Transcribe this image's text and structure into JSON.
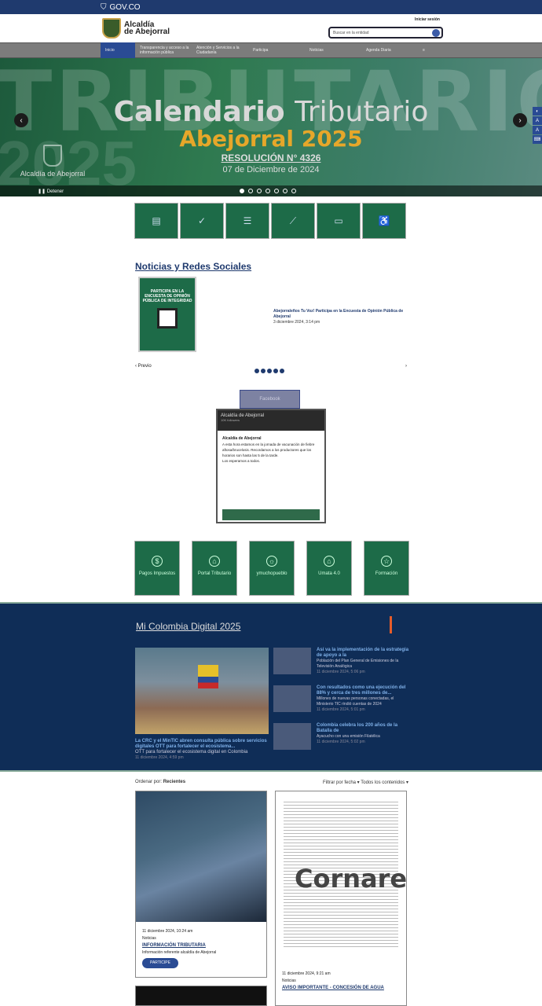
{
  "gov_bar": {
    "label": "GOV.CO"
  },
  "header": {
    "logo_line1": "Alcaldía",
    "logo_line2": "de Abejorral",
    "login": "Iniciar sesión",
    "search_placeholder": "Buscar en la entidad"
  },
  "nav": {
    "items": [
      "Inicio",
      "Transparencia y acceso a la información pública",
      "Atención y Servicios a la Ciudadanía",
      "Participa",
      "Noticias",
      "Agenda Diaria"
    ]
  },
  "hero": {
    "ghost": "TRIBUTARIO",
    "ghost2": "2025",
    "title_bold": "Calendario",
    "title_light": "Tributario",
    "subtitle": "Abejorral 2025",
    "resolution": "RESOLUCIÓN N° 4326",
    "date": "07 de Diciembre de 2024",
    "brand": "Alcaldía de Abejorral",
    "stop": "Detener"
  },
  "news": {
    "section_title": "Noticias y Redes Sociales",
    "poster_text": "PARTICIPA EN LA ENCUESTA DE OPINIÓN PÚBLICA DE INTEGRIDAD",
    "headline": "Abejorraleños Tu Voz! Participa en la Encuesta de Opinión Pública de Abejorral",
    "headline_date": "3 diciembre 2024, 3:14 pm",
    "prev": "Previo"
  },
  "facebook": {
    "button": "Facebook",
    "page": "Alcaldía de Abejorral",
    "followers": "10K followers",
    "post_author": "Alcaldía de Abejorral",
    "post_text": "A esta hora estamos en la jornada de vacunación de fiebre aftosa/brucelosis. Recordamos a los productores que los horarios son hasta las 5 de la tarde.",
    "post_more": "Los esperamos a todos."
  },
  "tiles": [
    {
      "icon": "$",
      "label": "Pagos Impuestos"
    },
    {
      "icon": "⌂",
      "label": "Portal Tributario"
    },
    {
      "icon": "☼",
      "label": "ymuchopueblo"
    },
    {
      "icon": "⌂",
      "label": "Umata 4.0"
    },
    {
      "icon": "☆",
      "label": "Formación"
    }
  ],
  "mincolombia": {
    "title": "Mi Colombia Digital 2025",
    "main_title": "La CRC y el MinTIC abren consulta pública sobre servicios digitales OTT para fortalecer el ecosistema...",
    "main_sub": "OTT para fortalecer el ecosistema digital en Colombia",
    "main_date": "11 diciembre 2024, 4:59 pm",
    "side": [
      {
        "title": "Así va la implementación de la estrategia de apoyo a la",
        "sub": "Población del Plan General de Emisiones de la Televisión Analógica",
        "date": "11 diciembre 2024, 5:06 pm"
      },
      {
        "title": "Con resultados como una ejecución del 88% y cerca de tres millones de...",
        "sub": "Millones de nuevas personas conectadas, el Ministerio TIC rindió cuentas de 2024",
        "date": "11 diciembre 2024, 5:01 pm"
      },
      {
        "title": "Colombia celebra los 200 años de la Batalla de",
        "sub": "Ayacucho con una emisión Filatélica",
        "date": "11 diciembre 2024, 5:02 pm"
      }
    ]
  },
  "feed": {
    "sort_label": "Ordenar por:",
    "sort_value": "Recientes",
    "filter_date": "Filtrar por fecha",
    "filter_all": "Todos los contenidos",
    "card1": {
      "date": "11 diciembre 2024, 10:24 am",
      "category": "Noticias",
      "title": "INFORMACIÓN TRIBUTARIA",
      "sub": "Información referente alcaldía de Abejorral",
      "button": "PARTICIPE"
    },
    "card2": {
      "stamp": "Cornare",
      "date": "11 diciembre 2024, 9:21 am",
      "category": "Noticias",
      "title": "AVISO IMPORTANTE - CONCESIÓN DE AGUA"
    }
  }
}
